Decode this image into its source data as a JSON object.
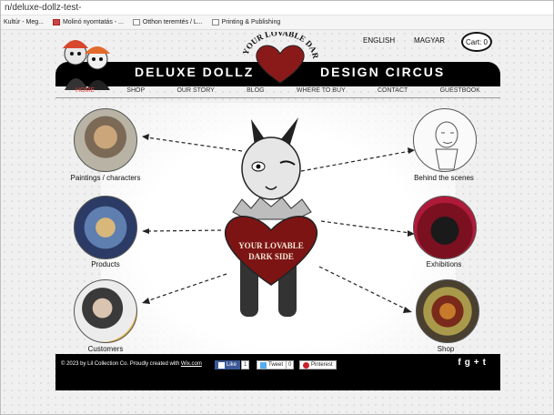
{
  "browser": {
    "url": "n/deluxe-dollz-test-",
    "bookmarks": [
      "Kultúr - Meg...",
      "Molinó nyomtatás - ...",
      "Otthon teremtés / L...",
      "Printing & Publishing"
    ]
  },
  "header": {
    "brand_left": "DELUXE DOLLZ",
    "brand_right": "DESIGN CIRCUS",
    "logo_text": "YOUR LOVABLE DARK SIDE",
    "lang_english": "ENGLISH",
    "lang_magyar": "MAGYAR",
    "cart_label": "Cart: 0"
  },
  "nav": {
    "items": [
      "HOME",
      "SHOP",
      "OUR STORY",
      "BLOG",
      "WHERE TO BUY",
      "CONTACT",
      "GUESTBOOK"
    ],
    "active": "HOME"
  },
  "center": {
    "heart_line1": "YOUR LOVABLE",
    "heart_line2": "DARK SIDE"
  },
  "circles": {
    "paintings": "Paintings / characters",
    "behind": "Behind the scenes",
    "products": "Products",
    "exhibitions": "Exhibitions",
    "customers": "Customers",
    "shop": "Shop"
  },
  "footer": {
    "copyright": "© 2023 by Lil Collection Co. Proudly created with ",
    "wix": "Wix.com",
    "like": "Like",
    "like_count": "1",
    "tweet": "Tweet",
    "tweet_count": "0",
    "pinterest": "Pinterest",
    "social_icons": [
      "facebook-icon",
      "google-plus-icon",
      "tumblr-icon"
    ]
  },
  "colors": {
    "accent_red": "#e0443c",
    "heart_red": "#8a1a1a",
    "black": "#000000"
  }
}
